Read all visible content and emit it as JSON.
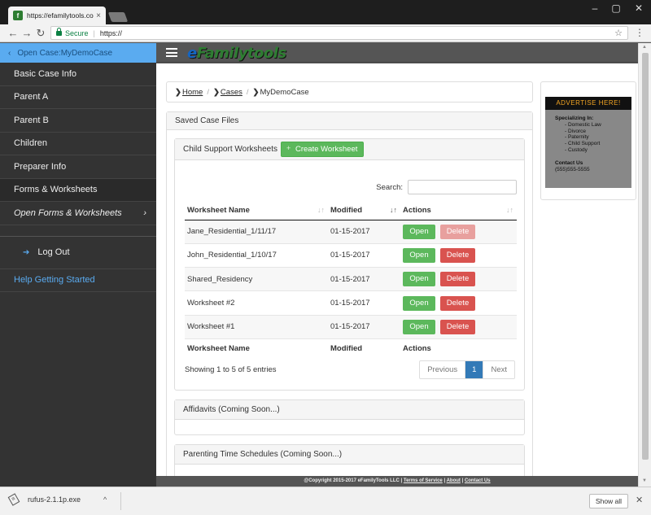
{
  "browser": {
    "tab_title": "https://efamilytools.com",
    "tab_close": "×",
    "url_secure": "Secure",
    "url": "https://",
    "window_controls": [
      "–",
      "▢",
      "✕"
    ],
    "back": "←",
    "forward": "→",
    "reload": "↻",
    "star": "☆",
    "menu": "⋮"
  },
  "sidebar": {
    "header": "Open Case:MyDemoCase",
    "header_chevron": "‹",
    "items": [
      {
        "label": "Basic Case Info"
      },
      {
        "label": "Parent A"
      },
      {
        "label": "Parent B"
      },
      {
        "label": "Children"
      },
      {
        "label": "Preparer Info"
      },
      {
        "label": "Forms & Worksheets"
      },
      {
        "label": "Open  Forms & Worksheets",
        "chevron": "›"
      }
    ],
    "logout": "Log Out",
    "logout_icon": "➔",
    "help": "Help Getting Started"
  },
  "header": {
    "logo_prefix": "e",
    "logo_rest": "Familytools"
  },
  "breadcrumb": {
    "items": [
      "Home",
      "Cases",
      "MyDemoCase"
    ],
    "chevron": "❯",
    "separator": "/"
  },
  "ad": {
    "title": "ADVERTISE HERE!",
    "specializing": "Specializing In:",
    "services": [
      "- Domestic Law",
      "- Divorce",
      "- Paternity",
      "- Child Support",
      "- Custody"
    ],
    "contact_label": "Contact Us",
    "phone": "(555)555-5555"
  },
  "saved": {
    "title": "Saved Case Files",
    "worksheets_title": "Child Support Worksheets",
    "create_button": "Create Worksheet",
    "search_label": "Search:",
    "search_value": "",
    "columns": [
      "Worksheet Name",
      "Modified",
      "Actions"
    ],
    "sort_icons": [
      "↓↑",
      "↓↑",
      "↓↑"
    ],
    "rows": [
      {
        "name": "Jane_Residential_1/11/17",
        "modified": "01-15-2017"
      },
      {
        "name": "John_Residential_1/10/17",
        "modified": "01-15-2017"
      },
      {
        "name": "Shared_Residency",
        "modified": "01-15-2017"
      },
      {
        "name": "Worksheet #2",
        "modified": "01-15-2017"
      },
      {
        "name": "Worksheet #1",
        "modified": "01-15-2017"
      }
    ],
    "open_label": "Open",
    "delete_label": "Delete",
    "info": "Showing 1 to 5 of 5 entries",
    "pager": {
      "previous": "Previous",
      "current": "1",
      "next": "Next"
    },
    "affidavits": "Affidavits (Coming Soon...)",
    "parenting": "Parenting Time Schedules (Coming Soon...)"
  },
  "footer": {
    "copyright": "@Copyright 2015-2017 eFamilyTools LLC |",
    "terms": "Terms of Service",
    "about": "About",
    "contact": "Contact Us",
    "pipe": "|"
  },
  "downloads": {
    "file": "rufus-2.1.1p.exe",
    "chevron": "^",
    "show_all": "Show all",
    "close": "✕"
  },
  "colors": {
    "accent": "#5aabf0",
    "success": "#5cb85c",
    "danger": "#d9534f",
    "primary": "#337ab7"
  }
}
